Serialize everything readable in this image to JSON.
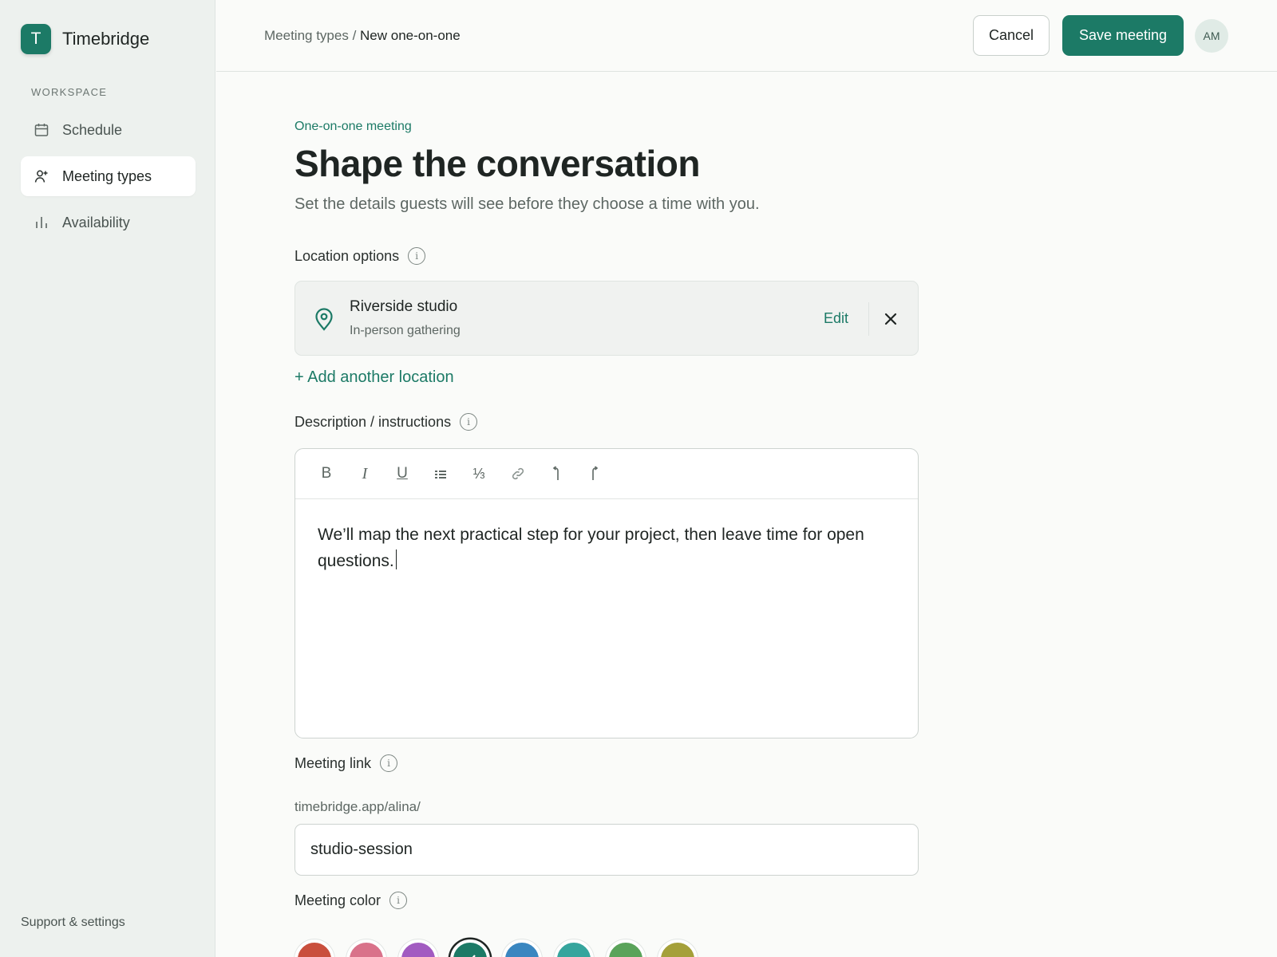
{
  "app": {
    "logo_letter": "T",
    "name": "Timebridge"
  },
  "sidebar": {
    "section_label": "WORKSPACE",
    "items": [
      {
        "label": "Schedule",
        "icon": "calendar-icon",
        "active": false
      },
      {
        "label": "Meeting types",
        "icon": "person-add-icon",
        "active": true
      },
      {
        "label": "Availability",
        "icon": "bar-chart-icon",
        "active": false
      }
    ],
    "footer_link": "Support & settings"
  },
  "header": {
    "breadcrumb_parent": "Meeting types",
    "breadcrumb_separator": " / ",
    "breadcrumb_current": "New one-on-one",
    "cancel_label": "Cancel",
    "save_label": "Save meeting",
    "avatar_initials": "AM"
  },
  "page": {
    "eyebrow": "One-on-one meeting",
    "title": "Shape the conversation",
    "subtitle": "Set the details guests will see before they choose a time with you."
  },
  "location": {
    "label": "Location options",
    "name": "Riverside studio",
    "type": "In-person gathering",
    "edit_label": "Edit",
    "add_label": "+ Add another location"
  },
  "description": {
    "label": "Description / instructions",
    "toolbar": [
      "bold-icon",
      "italic-icon",
      "underline-icon",
      "list-icon",
      "fraction-icon",
      "link-icon",
      "undo-icon",
      "redo-icon"
    ],
    "text": "We’ll map the next practical step for your project, then leave time for open questions."
  },
  "meeting_link": {
    "label": "Meeting link",
    "prefix": "timebridge.app/alina/",
    "value": "studio-session"
  },
  "meeting_color": {
    "label": "Meeting color",
    "options": [
      "#c94f3d",
      "#d9728a",
      "#a25bc1",
      "#1c7a66",
      "#3a86c0",
      "#36a59d",
      "#5aa35a",
      "#a5a03a"
    ],
    "selected": "#1c7a66"
  },
  "accent_color": "#1c7a66"
}
